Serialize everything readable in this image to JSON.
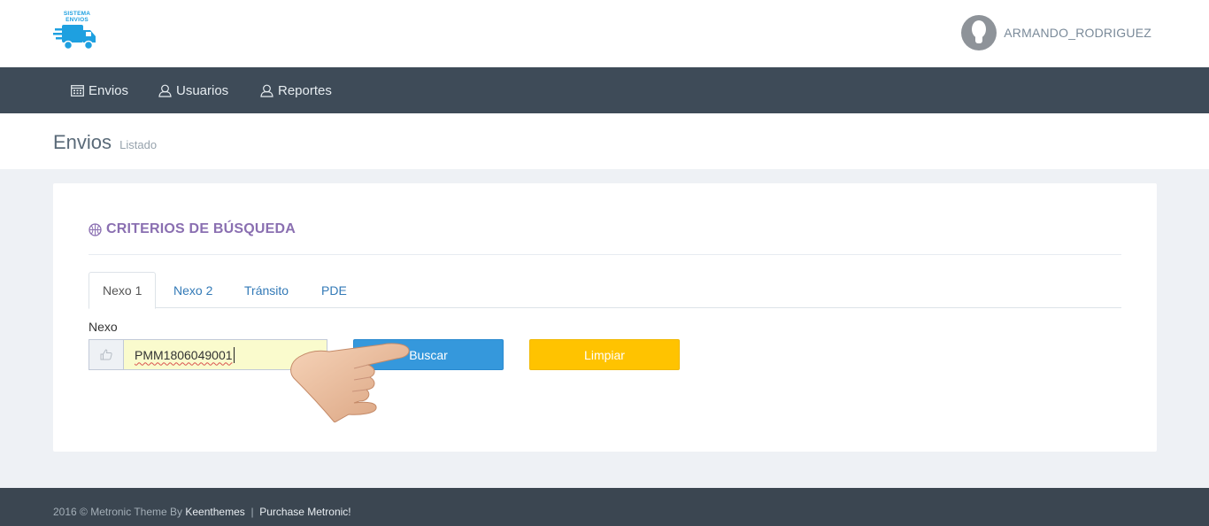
{
  "brand": {
    "logo_text": "SISTEMA ENVIOS"
  },
  "user": {
    "name": "ARMANDO_RODRIGUEZ"
  },
  "nav": {
    "items": [
      {
        "label": "Envios",
        "icon": "calendar-icon"
      },
      {
        "label": "Usuarios",
        "icon": "user-icon"
      },
      {
        "label": "Reportes",
        "icon": "user-icon"
      }
    ]
  },
  "page": {
    "title": "Envios",
    "subtitle": "Listado"
  },
  "search": {
    "title": "CRITERIOS DE BÚSQUEDA",
    "tabs": [
      "Nexo 1",
      "Nexo 2",
      "Tránsito",
      "PDE"
    ],
    "active_tab": "Nexo 1",
    "field_label": "Nexo",
    "field_value": "PMM1806049001",
    "buscar_label": "Buscar",
    "limpiar_label": "Limpiar"
  },
  "footer": {
    "copyright": "2016 © Metronic Theme By",
    "author": "Keenthemes",
    "separator": "|",
    "purchase": "Purchase Metronic!"
  },
  "colors": {
    "navbar": "#3e4b58",
    "accent_title": "#8a6fb1",
    "buscar": "#3598dc",
    "limpiar": "#ffc300",
    "input_bg": "#fafbcd"
  }
}
